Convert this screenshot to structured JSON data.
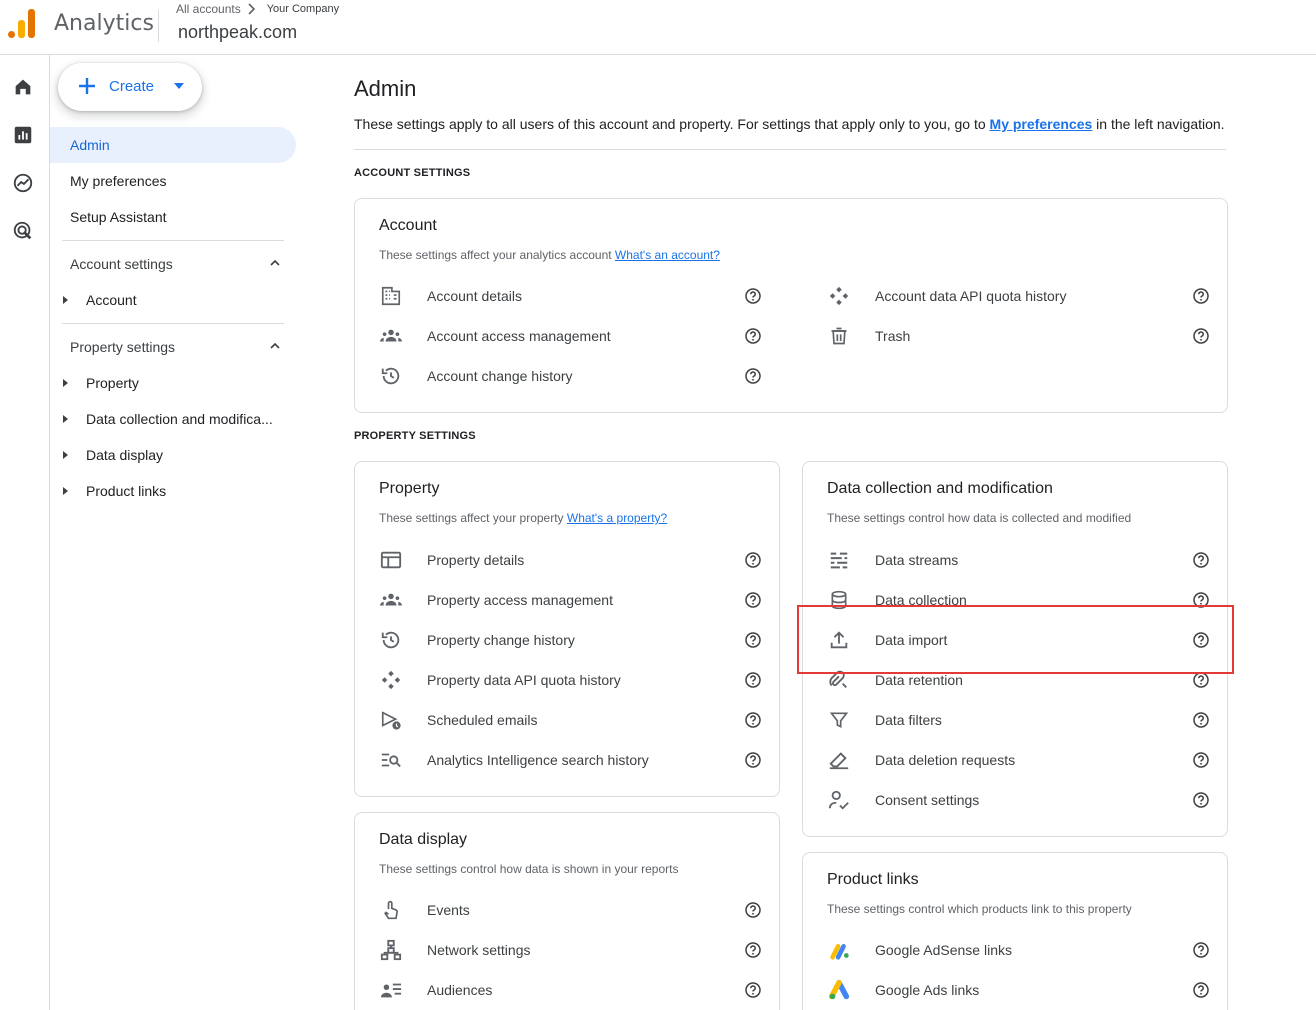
{
  "header": {
    "app_title": "Analytics",
    "breadcrumb_all": "All accounts",
    "breadcrumb_company": "Your Company",
    "property_name": "northpeak.com"
  },
  "rail": {
    "icons": [
      "home-icon",
      "reports-icon",
      "explore-icon",
      "advertising-icon"
    ]
  },
  "nav": {
    "create_label": "Create",
    "admin": "Admin",
    "my_preferences": "My preferences",
    "setup_assistant": "Setup Assistant",
    "account_settings": "Account settings",
    "account": "Account",
    "property_settings": "Property settings",
    "property": "Property",
    "data_collection": "Data collection and modifica...",
    "data_display": "Data display",
    "product_links": "Product links"
  },
  "main": {
    "title": "Admin",
    "desc_prefix": "These settings apply to all users of this account and property. For settings that apply only to you, go to ",
    "desc_link": "My preferences",
    "desc_suffix": " in the left navigation.",
    "account_settings_label": "ACCOUNT SETTINGS",
    "property_settings_label": "PROPERTY SETTINGS"
  },
  "account_card": {
    "title": "Account",
    "desc": "These settings affect your analytics account ",
    "desc_link": "What's an account?",
    "left_items": [
      {
        "label": "Account details",
        "icon": "building-icon"
      },
      {
        "label": "Account access management",
        "icon": "people-icon"
      },
      {
        "label": "Account change history",
        "icon": "history-icon"
      }
    ],
    "right_items": [
      {
        "label": "Account data API quota history",
        "icon": "api-icon"
      },
      {
        "label": "Trash",
        "icon": "trash-icon"
      }
    ]
  },
  "property_card": {
    "title": "Property",
    "desc": "These settings affect your property ",
    "desc_link": "What's a property?",
    "items": [
      {
        "label": "Property details",
        "icon": "web-icon"
      },
      {
        "label": "Property access management",
        "icon": "people-icon"
      },
      {
        "label": "Property change history",
        "icon": "history-icon"
      },
      {
        "label": "Property data API quota history",
        "icon": "api-icon"
      },
      {
        "label": "Scheduled emails",
        "icon": "scheduled-send-icon"
      },
      {
        "label": "Analytics Intelligence search history",
        "icon": "search-history-icon"
      }
    ]
  },
  "data_collection_card": {
    "title": "Data collection and modification",
    "desc": "These settings control how data is collected and modified",
    "items": [
      {
        "label": "Data streams",
        "icon": "streams-icon"
      },
      {
        "label": "Data collection",
        "icon": "database-icon"
      },
      {
        "label": "Data import",
        "icon": "upload-icon"
      },
      {
        "label": "Data retention",
        "icon": "retention-icon"
      },
      {
        "label": "Data filters",
        "icon": "filter-icon"
      },
      {
        "label": "Data deletion requests",
        "icon": "eraser-icon"
      },
      {
        "label": "Consent settings",
        "icon": "consent-icon"
      }
    ]
  },
  "data_display_card": {
    "title": "Data display",
    "desc": "These settings control how data is shown in your reports",
    "items": [
      {
        "label": "Events",
        "icon": "touch-icon"
      },
      {
        "label": "Network settings",
        "icon": "network-icon"
      },
      {
        "label": "Audiences",
        "icon": "audiences-icon"
      }
    ]
  },
  "product_links_card": {
    "title": "Product links",
    "desc": "These settings control which products link to this property",
    "items": [
      {
        "label": "Google AdSense links",
        "icon": "adsense-icon"
      },
      {
        "label": "Google Ads links",
        "icon": "google-ads-icon"
      }
    ]
  },
  "colors": {
    "accent": "#1a73e8",
    "highlight": "#e53935",
    "logo_orange": "#e37400",
    "logo_yellow": "#f9ab00"
  }
}
